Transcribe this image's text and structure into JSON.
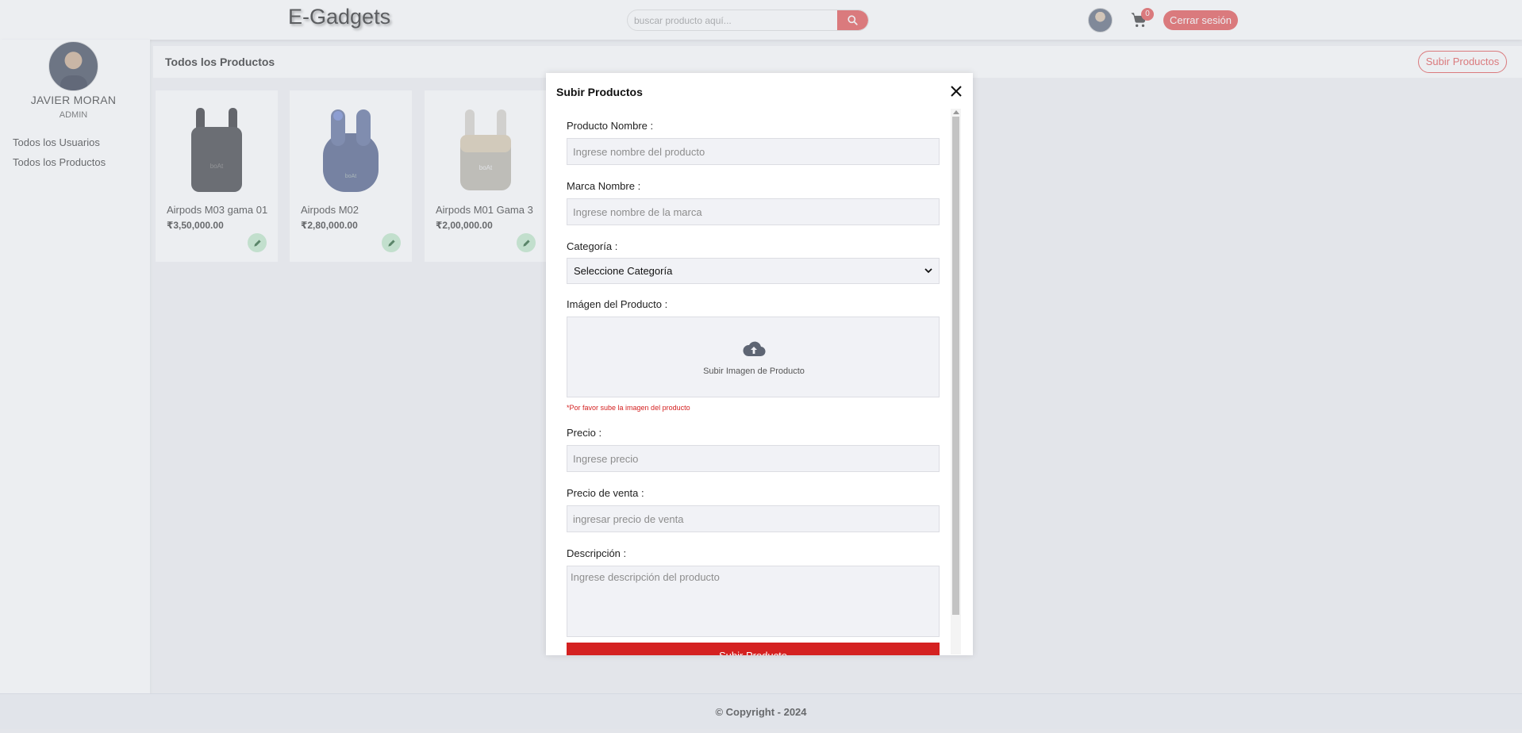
{
  "header": {
    "logo": "E-Gadgets",
    "search_placeholder": "buscar producto aquí...",
    "cart_count": "0",
    "logout_label": "Cerrar sesión"
  },
  "sidebar": {
    "user_name": "JAVIER MORAN",
    "user_role": "ADMIN",
    "links": [
      {
        "label": "Todos los Usuarios"
      },
      {
        "label": "Todos los Productos"
      }
    ]
  },
  "main": {
    "title": "Todos los Productos",
    "upload_button": "Subir Productos",
    "products": [
      {
        "name": "Airpods M03 gama 01",
        "price": "₹3,50,000.00",
        "color": "#3a3b40"
      },
      {
        "name": "Airpods M02",
        "price": "₹2,80,000.00",
        "color": "#4b5a86"
      },
      {
        "name": "Airpods M01 Gama 3",
        "price": "₹2,00,000.00",
        "color": "#b9b4a8"
      }
    ]
  },
  "modal": {
    "title": "Subir Productos",
    "fields": {
      "product_name_label": "Producto Nombre :",
      "product_name_placeholder": "Ingrese nombre del producto",
      "brand_label": "Marca Nombre :",
      "brand_placeholder": "Ingrese nombre de la marca",
      "category_label": "Categoría :",
      "category_selected": "Seleccione Categoría",
      "image_label": "Imágen del Producto :",
      "image_upload_text": "Subir Imagen de Producto",
      "image_warning": "*Por favor sube la imagen del producto",
      "price_label": "Precio :",
      "price_placeholder": "Ingrese precio",
      "sale_price_label": "Precio de venta :",
      "sale_price_placeholder": "ingresar precio de venta",
      "description_label": "Descripción :",
      "description_placeholder": "Ingrese descripción del producto"
    },
    "submit_label": "Subir Producto"
  },
  "footer": {
    "copyright": "© Copyright - 2024"
  },
  "colors": {
    "accent": "#e44d4d",
    "submit": "#d42121",
    "edit_badge": "#bfe8c8"
  }
}
